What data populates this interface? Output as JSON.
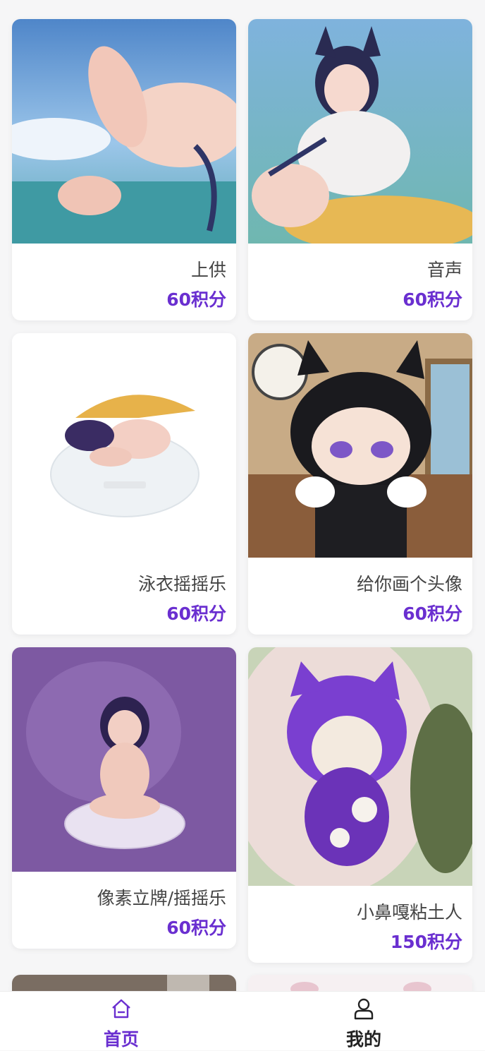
{
  "products": [
    {
      "title": "上供",
      "price": "60积分",
      "image": "beach-legs-illustration"
    },
    {
      "title": "音声",
      "price": "60积分",
      "image": "wolf-girl-swim-illustration"
    },
    {
      "title": "泳衣摇摇乐",
      "price": "60积分",
      "image": "acrylic-stand-umbrella"
    },
    {
      "title": "给你画个头像",
      "price": "60积分",
      "image": "chibi-maid-avatar"
    },
    {
      "title": "像素立牌/摇摇乐",
      "price": "60积分",
      "image": "pixel-acrylic-stand"
    },
    {
      "title": "小鼻嘎粘土人",
      "price": "150积分",
      "image": "clay-figure-photo"
    }
  ],
  "tabbar": {
    "home_label": "首页",
    "mine_label": "我的",
    "active_color": "#6a2fd0",
    "inactive_color": "#222222"
  },
  "colors": {
    "accent": "#6a2fd0",
    "background": "#f6f6f7",
    "card": "#ffffff"
  }
}
